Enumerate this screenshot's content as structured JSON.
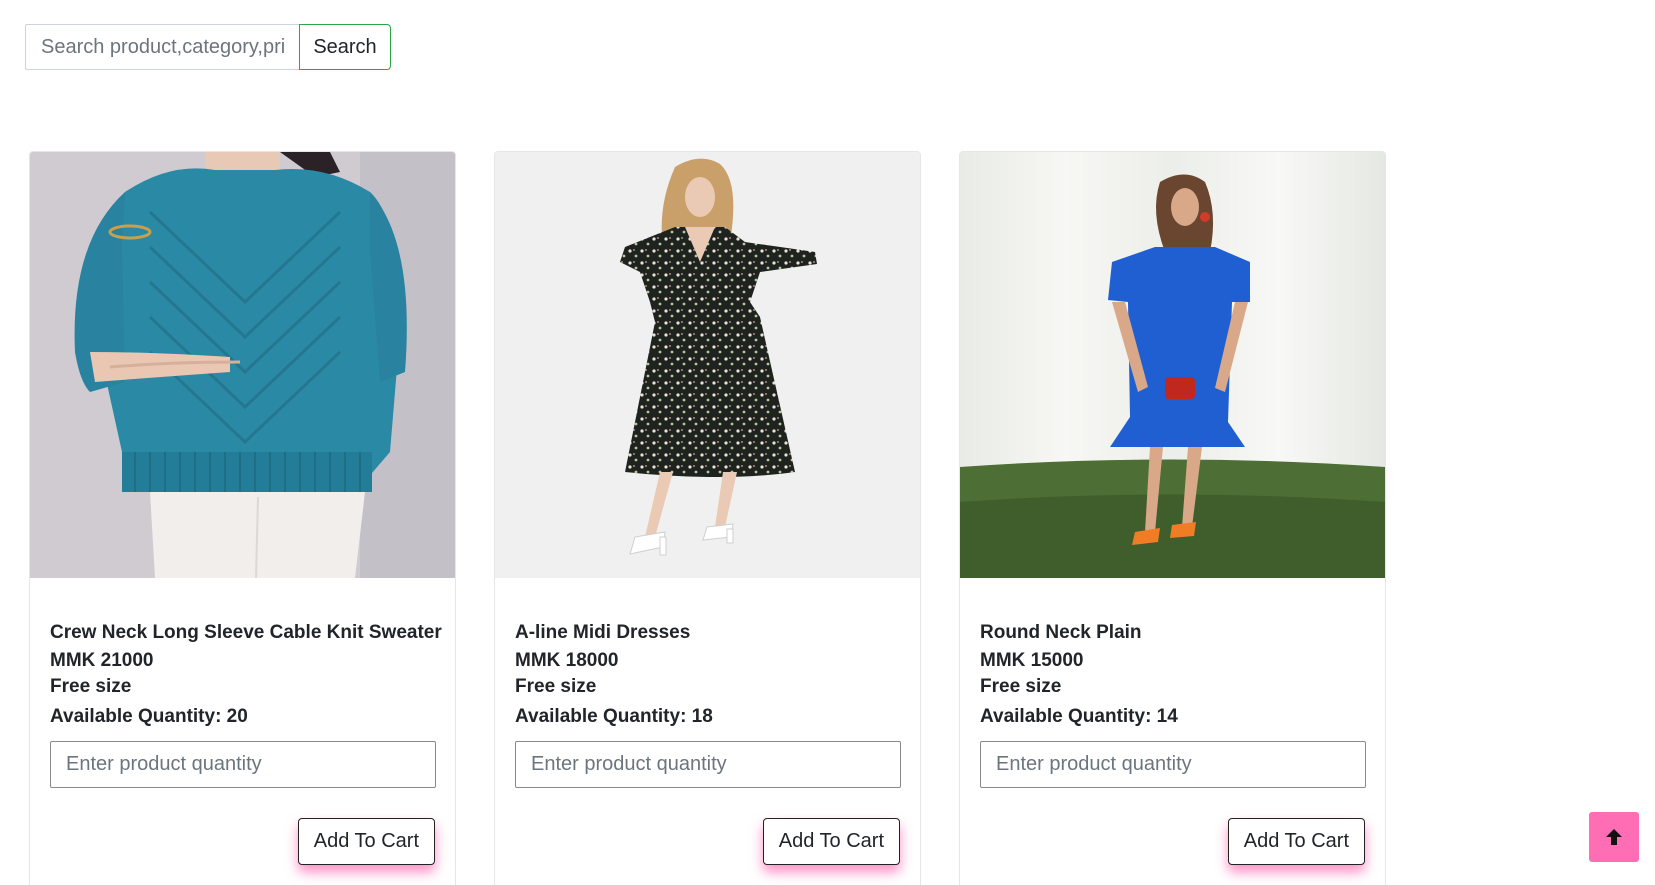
{
  "search": {
    "placeholder": "Search product,category,pri",
    "button_label": "Search"
  },
  "products": [
    {
      "name": "Crew Neck Long Sleeve Cable Knit Sweater",
      "price": "MMK 21000",
      "size": "Free size",
      "available": "Available Quantity: 20",
      "qty_placeholder": "Enter product quantity",
      "button_label": "Add To Cart",
      "image": "teal-knit-sweater-photo"
    },
    {
      "name": "A-line Midi Dresses",
      "price": "MMK 18000",
      "size": "Free size",
      "available": "Available Quantity: 18",
      "qty_placeholder": "Enter product quantity",
      "button_label": "Add To Cart",
      "image": "floral-midi-dress-photo"
    },
    {
      "name": "Round Neck Plain",
      "price": "MMK 15000",
      "size": "Free size",
      "available": "Available Quantity: 14",
      "qty_placeholder": "Enter product quantity",
      "button_label": "Add To Cart",
      "image": "blue-dress-photo"
    }
  ],
  "scroll_top": {
    "icon": "arrow-up-icon"
  },
  "colors": {
    "search_button_border": "#28a745",
    "scroll_top_bg": "#ff6eb4",
    "button_shadow": "#ff69b4"
  }
}
